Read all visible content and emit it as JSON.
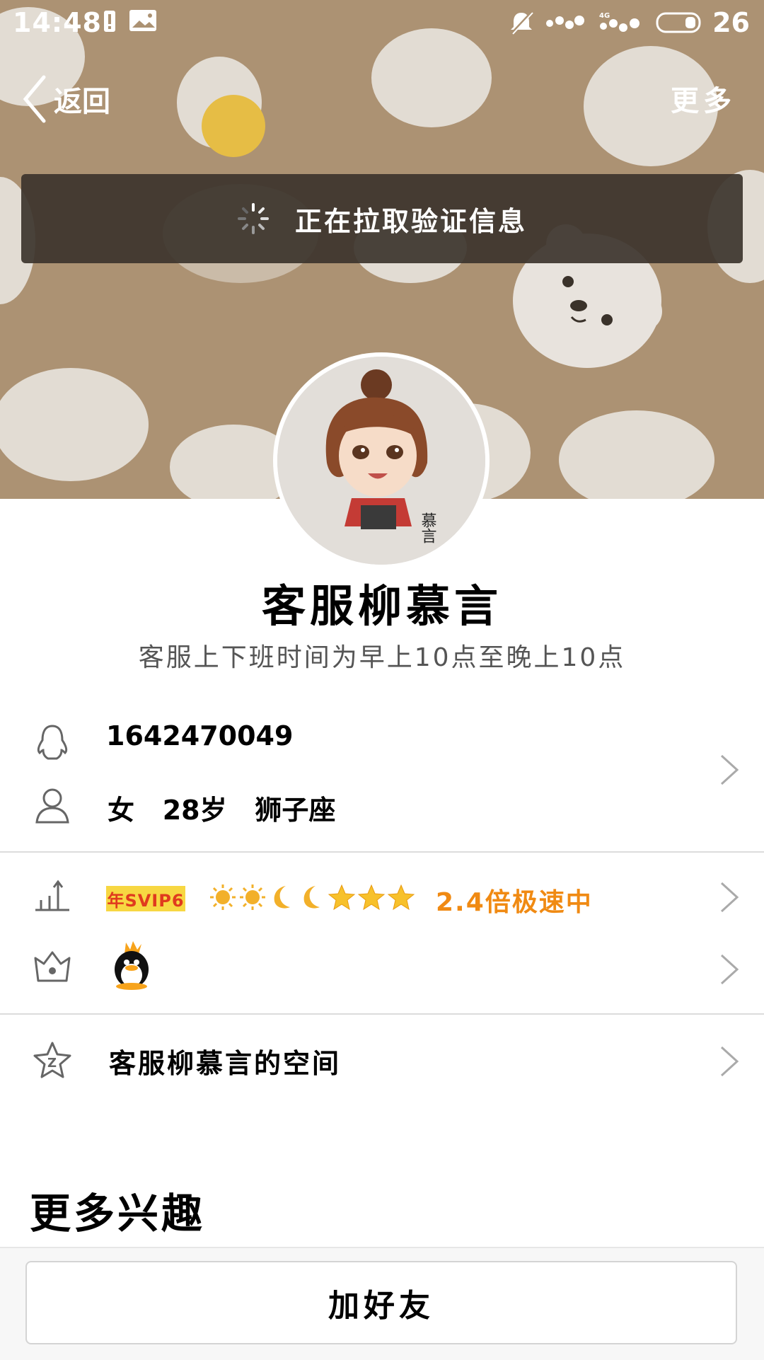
{
  "status_bar": {
    "time": "14:48",
    "battery_level": "26",
    "network": "4G"
  },
  "nav": {
    "back_label": "返回",
    "more_label": "更多"
  },
  "toast": {
    "message": "正在拉取验证信息"
  },
  "profile": {
    "name": "客服柳慕言",
    "signature": "客服上下班时间为早上10点至晚上10点",
    "avatar_caption": "慕言"
  },
  "info": {
    "qq_number": "1642470049",
    "gender": "女",
    "age": "28岁",
    "zodiac": "狮子座"
  },
  "level": {
    "vip_badge": "年SVIP6",
    "level_icons": [
      "sun-icon",
      "sun-icon",
      "moon-icon",
      "moon-icon",
      "star-icon",
      "star-icon",
      "star-icon"
    ],
    "speed_text": "2.4倍极速中",
    "speed_color": "#f08a13"
  },
  "qzone": {
    "label": "客服柳慕言的空间"
  },
  "interests": {
    "title": "更多兴趣"
  },
  "actions": {
    "add_friend": "加好友"
  }
}
